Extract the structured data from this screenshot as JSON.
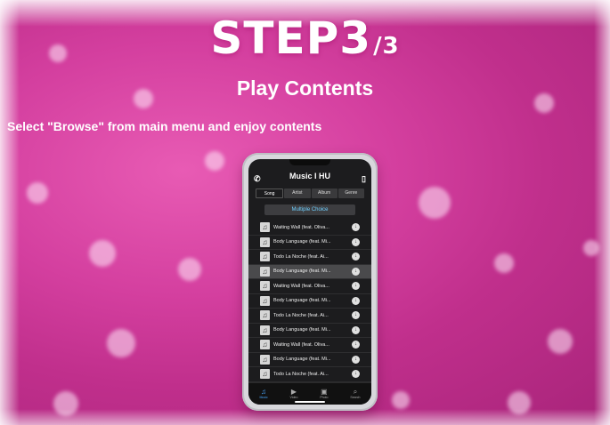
{
  "step": {
    "title": "STEP3",
    "fraction": "/3"
  },
  "subtitle": "Play Contents",
  "instruction": "Select \"Browse\" from main menu and enjoy contents",
  "app": {
    "title": "Music I HU",
    "left_icon": "phone-icon",
    "right_icon": "phone-icon",
    "tabs": [
      {
        "label": "Song",
        "active": true
      },
      {
        "label": "Artist",
        "active": false
      },
      {
        "label": "Album",
        "active": false
      },
      {
        "label": "Genre",
        "active": false
      }
    ],
    "multiple_choice": "Multiple Choice",
    "songs": [
      {
        "title": "Waiting Wall (feat. Oliva...",
        "selected": false
      },
      {
        "title": "Body Language (feat. Mi...",
        "selected": false
      },
      {
        "title": "Todo La Noche (feat. Ai...",
        "selected": false
      },
      {
        "title": "Body Language (feat. Mi...",
        "selected": true
      },
      {
        "title": "Waiting Wall (feat. Oliva...",
        "selected": false
      },
      {
        "title": "Body Language (feat. Mi...",
        "selected": false
      },
      {
        "title": "Todo La Noche (feat. Ai...",
        "selected": false
      },
      {
        "title": "Body Language (feat. Mi...",
        "selected": false
      },
      {
        "title": "Waiting Wall (feat. Oliva...",
        "selected": false
      },
      {
        "title": "Body Language (feat. Mi...",
        "selected": false
      },
      {
        "title": "Todo La Noche (feat. Ai...",
        "selected": false
      }
    ],
    "bottom_nav": [
      {
        "label": "Music",
        "icon": "music-note-icon",
        "active": true
      },
      {
        "label": "Video",
        "icon": "video-icon",
        "active": false
      },
      {
        "label": "Photo",
        "icon": "photo-icon",
        "active": false
      },
      {
        "label": "Search",
        "icon": "search-icon",
        "active": false
      }
    ]
  },
  "colors": {
    "background": "#d43f9f",
    "accent": "#6fd0ff",
    "active_nav": "#4aa8ff"
  }
}
